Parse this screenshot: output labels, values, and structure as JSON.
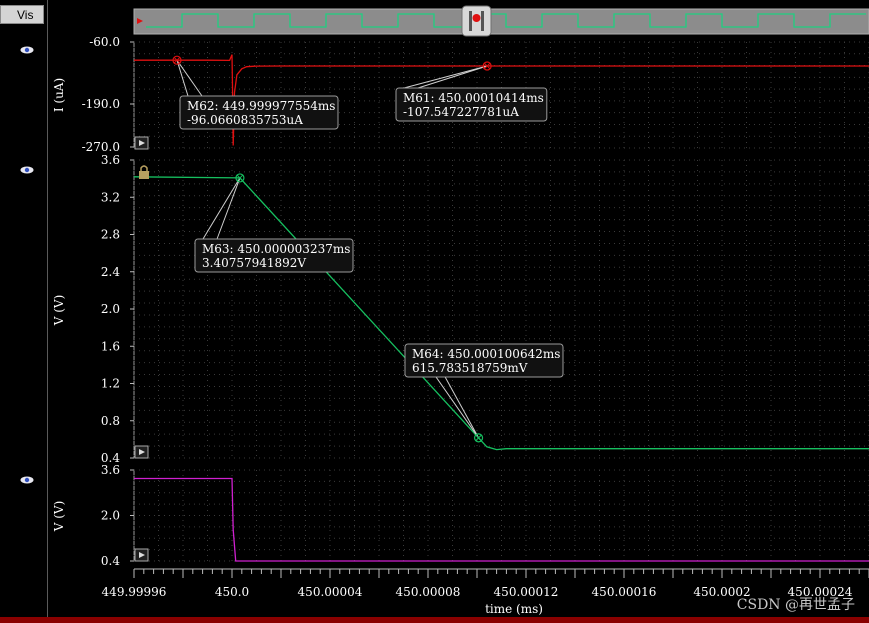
{
  "sidebar": {
    "tab_label": "Vis"
  },
  "watermark": "CSDN @再世孟子",
  "colors": {
    "current": "#e01010",
    "voltage": "#16c060",
    "control": "#d020d0",
    "grid": "#2e2e2e",
    "text": "#ffffff"
  },
  "chart_data": [
    {
      "type": "line",
      "ylabel": "I (uA)",
      "ylim": [
        -270.0,
        -60.0
      ],
      "yticks": [
        "-60.0",
        "-190.0",
        "-270.0"
      ],
      "ytick_values": [
        -60.0,
        -190.0,
        -270.0
      ],
      "series": [
        {
          "color": "#e01010",
          "x": [
            449.99996,
            449.99999,
            449.999999,
            450.0,
            450.0000002,
            450.0000005,
            450.000001,
            450.000002,
            450.000004,
            450.000006,
            450.00001,
            450.00002,
            450.00004,
            450.00008,
            450.00012,
            450.00016,
            450.0002,
            450.00024,
            450.00026
          ],
          "y": [
            -96.1,
            -96.1,
            -96.5,
            -85.0,
            -150.0,
            -265.0,
            -160.0,
            -125.0,
            -113.0,
            -109.0,
            -107.8,
            -107.6,
            -107.55,
            -107.55,
            -107.55,
            -107.55,
            -107.55,
            -107.55,
            -107.55
          ]
        }
      ],
      "markers": [
        {
          "name": "M62",
          "x": 449.999977554,
          "y": -96.0660835753,
          "line1": "M62: 449.999977554ms",
          "line2": "-96.0660835753uA"
        },
        {
          "name": "M61",
          "x": 450.00010414,
          "y": -107.547227781,
          "line1": "M61: 450.00010414ms",
          "line2": "-107.547227781uA"
        }
      ]
    },
    {
      "type": "line",
      "ylabel": "V (V)",
      "ylim": [
        0.4,
        3.6
      ],
      "yticks": [
        "3.6",
        "3.2",
        "2.8",
        "2.4",
        "2.0",
        "1.6",
        "1.2",
        "0.8",
        "0.4"
      ],
      "ytick_values": [
        3.6,
        3.2,
        2.8,
        2.4,
        2.0,
        1.6,
        1.2,
        0.8,
        0.4
      ],
      "series": [
        {
          "color": "#16c060",
          "x": [
            449.99996,
            450.000003237,
            450.000100642,
            450.000104,
            450.000108,
            450.000112,
            450.00016,
            450.0002,
            450.00026
          ],
          "y": [
            3.42,
            3.40757941892,
            0.615783518759,
            0.52,
            0.49,
            0.5,
            0.5,
            0.5,
            0.5
          ]
        }
      ],
      "markers": [
        {
          "name": "M63",
          "x": 450.000003237,
          "y": 3.40757941892,
          "line1": "M63: 450.000003237ms",
          "line2": "3.40757941892V"
        },
        {
          "name": "M64",
          "x": 450.000100642,
          "y": 0.615783518759,
          "line1": "M64: 450.000100642ms",
          "line2": "615.783518759mV"
        }
      ]
    },
    {
      "type": "line",
      "ylabel": "V (V)",
      "ylim": [
        0.4,
        3.6
      ],
      "yticks": [
        "3.6",
        "2.0",
        "0.4"
      ],
      "ytick_values": [
        3.6,
        2.0,
        0.4
      ],
      "series": [
        {
          "color": "#d020d0",
          "x": [
            449.99996,
            450.0,
            450.0000005,
            450.0000015,
            450.00026
          ],
          "y": [
            3.3,
            3.3,
            1.5,
            0.4,
            0.4
          ]
        }
      ],
      "markers": []
    }
  ],
  "x_axis": {
    "label": "time (ms)",
    "xlim": [
      449.99996,
      450.00026
    ],
    "ticks": [
      {
        "v": 449.99996,
        "label": "449.99996"
      },
      {
        "v": 450.0,
        "label": "450.0"
      },
      {
        "v": 450.00004,
        "label": "450.00004"
      },
      {
        "v": 450.00008,
        "label": "450.00008"
      },
      {
        "v": 450.00012,
        "label": "450.00012"
      },
      {
        "v": 450.00016,
        "label": "450.00016"
      },
      {
        "v": 450.0002,
        "label": "450.0002"
      },
      {
        "v": 450.00024,
        "label": "450.00024"
      }
    ]
  }
}
